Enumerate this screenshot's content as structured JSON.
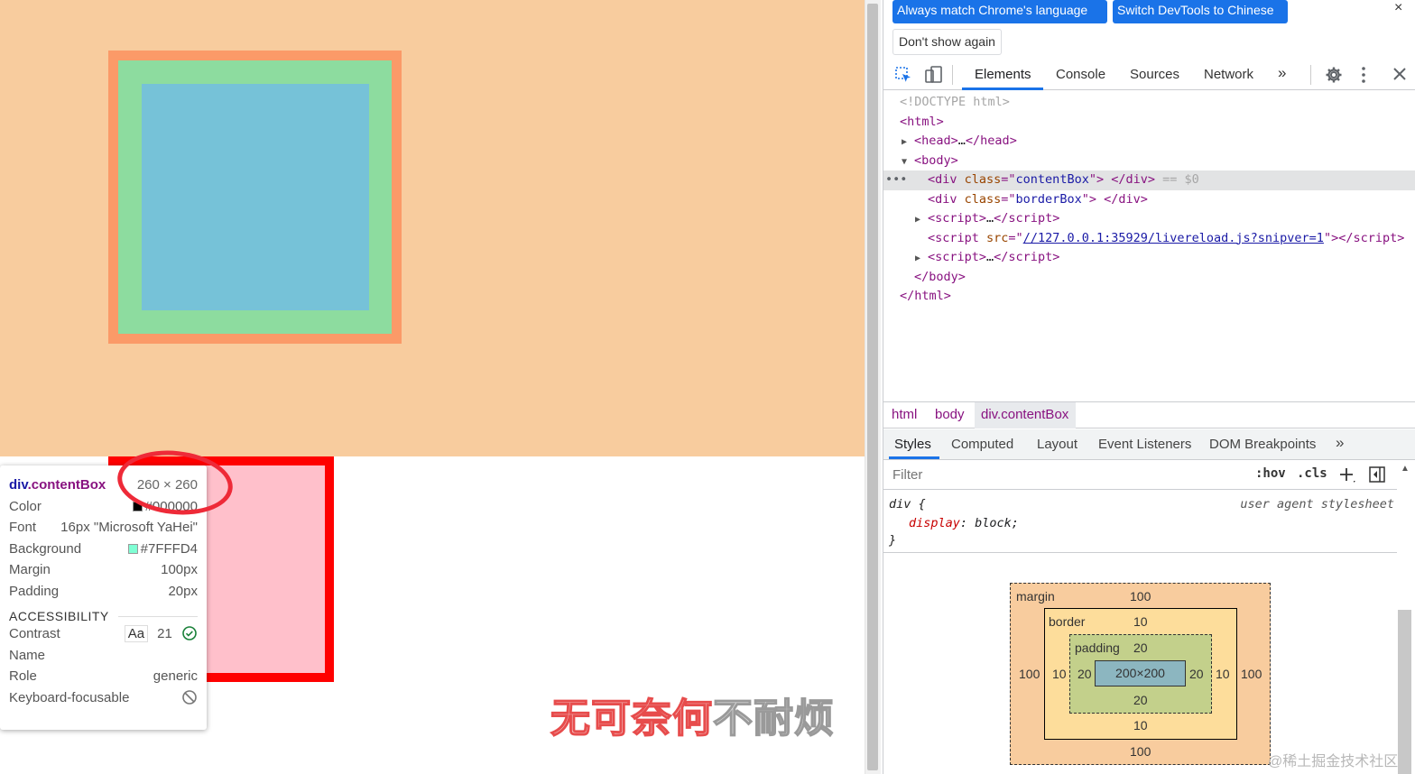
{
  "tooltip": {
    "element_tag": "div",
    "element_class": ".contentBox",
    "size": "260 × 260",
    "rows": [
      {
        "label": "Color",
        "value": "#000000",
        "swatch": "#000000"
      },
      {
        "label": "Font",
        "value": "16px \"Microsoft YaHei\""
      },
      {
        "label": "Background",
        "value": "#7FFFD4",
        "swatch": "#7fffd4"
      },
      {
        "label": "Margin",
        "value": "100px"
      },
      {
        "label": "Padding",
        "value": "20px"
      }
    ],
    "accessibility_heading": "ACCESSIBILITY",
    "accessibility": {
      "contrast_label": "Contrast",
      "contrast_aa": "Aa",
      "contrast_value": "21",
      "name_label": "Name",
      "role_label": "Role",
      "role_value": "generic",
      "keyboard_label": "Keyboard-focusable"
    }
  },
  "watermark_text": {
    "red": "无可奈何",
    "grey": "不耐烦"
  },
  "devtools": {
    "infobar": {
      "match_language_button": "Always match Chrome's language",
      "switch_chinese_button": "Switch DevTools to Chinese",
      "dont_show_button": "Don't show again",
      "close": "×"
    },
    "tabs": [
      "Elements",
      "Console",
      "Sources",
      "Network"
    ],
    "more_tabs": "»",
    "dom": {
      "doctype": "<!DOCTYPE html>",
      "html_open": "<html>",
      "head_tag": "<head>",
      "ellipsis": "…",
      "head_close": "</head>",
      "body_open": "<body>",
      "div1_class": "contentBox",
      "div2_class": "borderBox",
      "script_src": "//127.0.0.1:35929/livereload.js?snipver=1",
      "selected_marker": "== $0",
      "body_close": "</body>",
      "html_close": "</html>"
    },
    "breadcrumb": [
      "html",
      "body",
      "div.contentBox"
    ],
    "styles_tabs": [
      "Styles",
      "Computed",
      "Layout",
      "Event Listeners",
      "DOM Breakpoints"
    ],
    "filter_placeholder": "Filter",
    "hov": ":hov",
    "cls": ".cls",
    "rule": {
      "selector": "div {",
      "origin": "user agent stylesheet",
      "property": "display",
      "value": "block;",
      "close": "}"
    },
    "box_model": {
      "margin_label": "margin",
      "margin": {
        "top": "100",
        "right": "100",
        "bottom": "100",
        "left": "100"
      },
      "border_label": "border",
      "border": {
        "top": "10",
        "right": "10",
        "bottom": "10",
        "left": "10"
      },
      "padding_label": "padding",
      "padding": {
        "top": "20",
        "right": "20",
        "bottom": "20",
        "left": "20"
      },
      "content": "200×200"
    }
  },
  "site_watermark": "@稀土掘金技术社区",
  "colors": {
    "margin_overlay": "#f8cc9e",
    "border_overlay": "#fb9a68",
    "padding_overlay": "#8ddc9f",
    "content_overlay": "#76c2d8",
    "border_box_border": "#ff0000",
    "border_box_bg": "#ffc0cb",
    "devtools_accent": "#1a73e8"
  }
}
